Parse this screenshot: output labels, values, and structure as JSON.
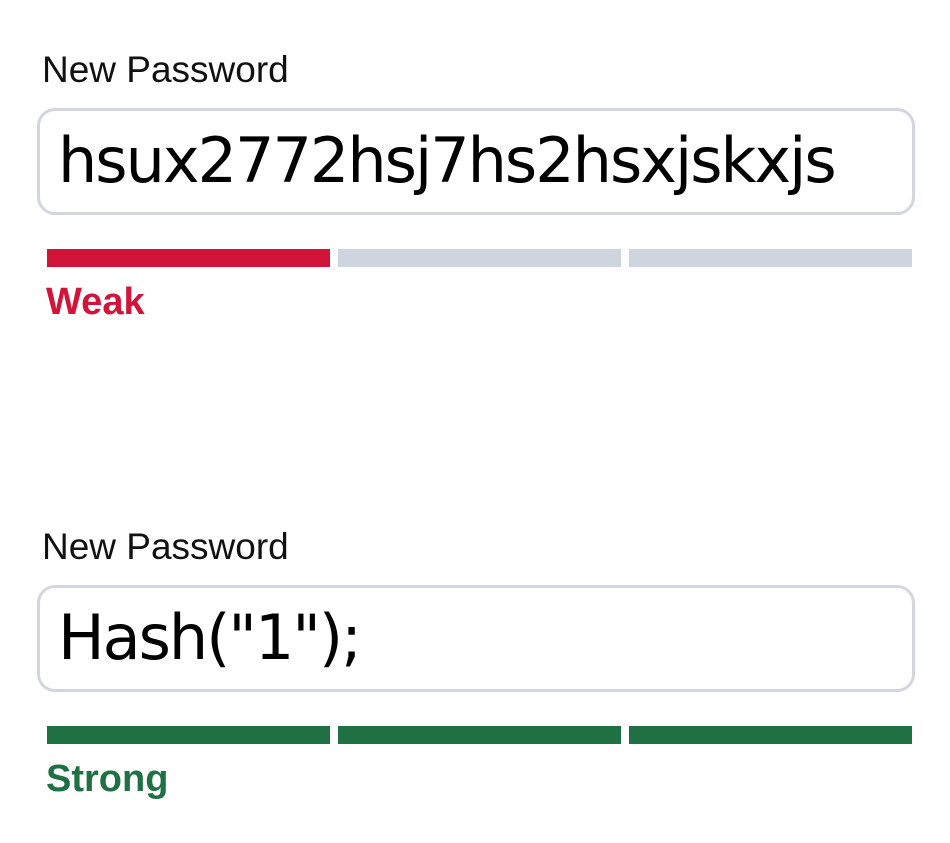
{
  "colors": {
    "weak": "#d2143a",
    "strong": "#1f7042",
    "empty_segment": "#cfd5df",
    "input_border": "#d3d6de"
  },
  "fields": [
    {
      "label": "New Password",
      "value": "hsux2772hsj7hs2hsxjskxjs",
      "strength": {
        "label": "Weak",
        "filled_segments": 1,
        "total_segments": 3,
        "color": "#d2143a"
      }
    },
    {
      "label": "New Password",
      "value": "Hash(\"1\");",
      "strength": {
        "label": "Strong",
        "filled_segments": 3,
        "total_segments": 3,
        "color": "#1f7042"
      }
    }
  ]
}
